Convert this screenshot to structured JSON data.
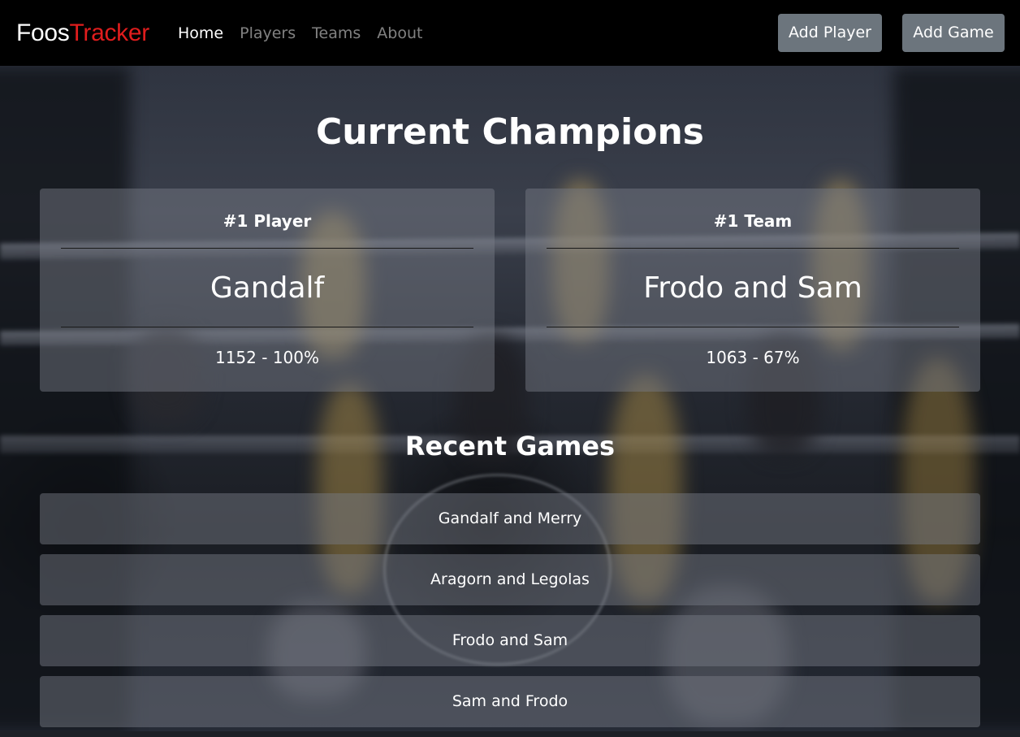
{
  "nav": {
    "brand_part1": "Foos",
    "brand_part2": "Tracker",
    "links": [
      {
        "label": "Home",
        "active": true
      },
      {
        "label": "Players",
        "active": false
      },
      {
        "label": "Teams",
        "active": false
      },
      {
        "label": "About",
        "active": false
      }
    ],
    "add_player_label": "Add Player",
    "add_game_label": "Add Game"
  },
  "champions": {
    "title": "Current Champions",
    "player": {
      "label": "#1 Player",
      "name": "Gandalf",
      "stats": "1152 - 100%"
    },
    "team": {
      "label": "#1 Team",
      "name": "Frodo and Sam",
      "stats": "1063 - 67%"
    }
  },
  "recent_games": {
    "title": "Recent Games",
    "items": [
      "Gandalf and Merry",
      "Aragorn and Legolas",
      "Frodo and Sam",
      "Sam and Frodo"
    ]
  },
  "colors": {
    "navbar_bg": "#000000",
    "brand_accent": "#e01d1d",
    "button_bg": "#6c757d",
    "nav_link_inactive": "#808080"
  }
}
